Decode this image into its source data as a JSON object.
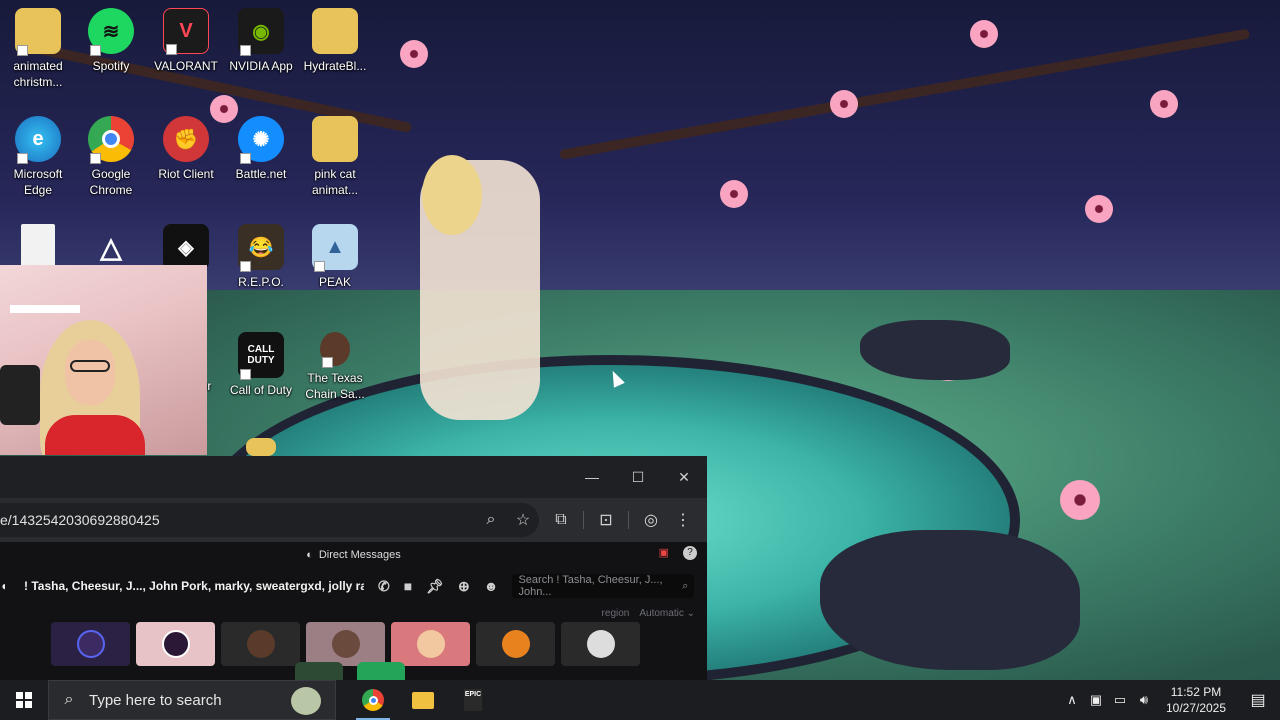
{
  "desktop": {
    "icons": [
      {
        "label": "animated christm...",
        "icon": "folder-icon"
      },
      {
        "label": "Spotify",
        "icon": "spotify-icon"
      },
      {
        "label": "VALORANT",
        "icon": "valorant-icon"
      },
      {
        "label": "NVIDIA App",
        "icon": "nvidia-icon"
      },
      {
        "label": "HydrateBl...",
        "icon": "folder-icon"
      },
      {
        "label": "Microsoft Edge",
        "icon": "edge-icon"
      },
      {
        "label": "Google Chrome",
        "icon": "chrome-icon"
      },
      {
        "label": "Riot Client",
        "icon": "riot-icon"
      },
      {
        "label": "Battle.net",
        "icon": "battlenet-icon"
      },
      {
        "label": "pink cat animat...",
        "icon": "folder-icon"
      },
      {
        "label": "R.E.P.O.",
        "icon": "repo-icon"
      },
      {
        "label": "PEAK",
        "icon": "peak-icon"
      },
      {
        "label": "yer",
        "icon": "partial-icon"
      },
      {
        "label": "Call of Duty",
        "icon": "call-of-duty-icon"
      },
      {
        "label": "The Texas Chain Sa...",
        "icon": "texas-chainsaw-icon"
      }
    ],
    "colors": {
      "blossom": "#f9a4c0",
      "pond": "#3bb3a6",
      "sky": "#27275a"
    }
  },
  "browser": {
    "url": "e/1432542030692880425",
    "window_controls": {
      "minimize": "—",
      "maximize": "☐",
      "close": "✕"
    }
  },
  "discord": {
    "section_title": "Direct Messages",
    "channel_name": "! Tasha, Cheesur, J..., John Pork, marky, sweatergxd, jolly rancher",
    "search_placeholder": "Search ! Tasha, Cheesur, J..., John...",
    "region_label": "region",
    "region_value": "Automatic",
    "tile_colors": [
      "#2b2145",
      "#e7c3c8",
      "#2a2a2a",
      "#9c7f84",
      "#d9797d",
      "#2a2a2a",
      "#2a2a2a"
    ]
  },
  "taskbar": {
    "search_placeholder": "Type here to search",
    "time": "11:52 PM",
    "date": "10/27/2025",
    "apps": [
      "chrome-icon",
      "file-explorer-icon",
      "epic-games-icon"
    ]
  }
}
